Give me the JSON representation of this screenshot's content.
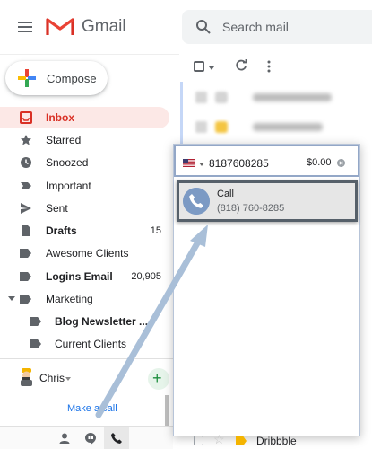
{
  "header": {
    "app_name": "Gmail",
    "search_placeholder": "Search mail"
  },
  "compose": {
    "label": "Compose"
  },
  "sidebar": {
    "items": [
      {
        "label": "Inbox",
        "count": "",
        "icon": "inbox-icon",
        "active": true
      },
      {
        "label": "Starred",
        "count": "",
        "icon": "star-icon"
      },
      {
        "label": "Snoozed",
        "count": "",
        "icon": "clock-icon"
      },
      {
        "label": "Important",
        "count": "",
        "icon": "important-icon"
      },
      {
        "label": "Sent",
        "count": "",
        "icon": "send-icon"
      },
      {
        "label": "Drafts",
        "count": "15",
        "icon": "draft-icon"
      },
      {
        "label": "Awesome Clients",
        "count": "",
        "icon": "label-icon"
      },
      {
        "label": "Logins Email",
        "count": "20,905",
        "icon": "label-icon"
      },
      {
        "label": "Marketing",
        "count": "",
        "icon": "label-icon"
      },
      {
        "label": "Blog Newsletter ...",
        "count": "",
        "icon": "label-icon"
      },
      {
        "label": "Current Clients",
        "count": "",
        "icon": "label-icon"
      }
    ]
  },
  "hangouts": {
    "user_name": "Chris",
    "add_label": "+",
    "make_call_label": "Make a call"
  },
  "dialer": {
    "country": "US",
    "number": "8187608285",
    "price": "$0.00",
    "call_label": "Call",
    "call_number": "(818) 760-8285"
  },
  "mail_list": {
    "peek_sender": "Dribbble"
  },
  "colors": {
    "active_bg": "#fce8e6",
    "active_text": "#d93025",
    "link": "#1a73e8",
    "add_green": "#1e8e3e",
    "call_card_border": "#56606a",
    "arrow": "#a9bfd8"
  }
}
